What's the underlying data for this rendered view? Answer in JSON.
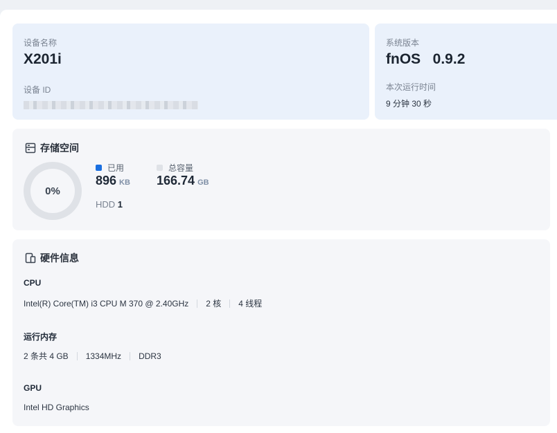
{
  "device": {
    "name_label": "设备名称",
    "name": "X201i",
    "id_label": "设备 ID"
  },
  "system": {
    "version_label": "系统版本",
    "version": "fnOS   0.9.2",
    "uptime_label": "本次运行时间",
    "uptime": "9 分钟 30 秒"
  },
  "storage": {
    "title": "存储空间",
    "percent": "0%",
    "used_label": "已用",
    "used_value": "896",
    "used_unit": "KB",
    "total_label": "总容量",
    "total_value": "166.74",
    "total_unit": "GB",
    "hdd_label": "HDD",
    "hdd_count": "1",
    "colors": {
      "used": "#1a6fe0",
      "free": "#dfe2e7"
    }
  },
  "hardware": {
    "title": "硬件信息",
    "cpu_label": "CPU",
    "cpu_model": "Intel(R) Core(TM) i3 CPU M 370 @ 2.40GHz",
    "cpu_cores": "2 核",
    "cpu_threads": "4 线程",
    "memory_label": "运行内存",
    "memory_slots": "2 条共 4 GB",
    "memory_speed": "1334MHz",
    "memory_type": "DDR3",
    "gpu_label": "GPU",
    "gpu_model": "Intel HD Graphics"
  }
}
